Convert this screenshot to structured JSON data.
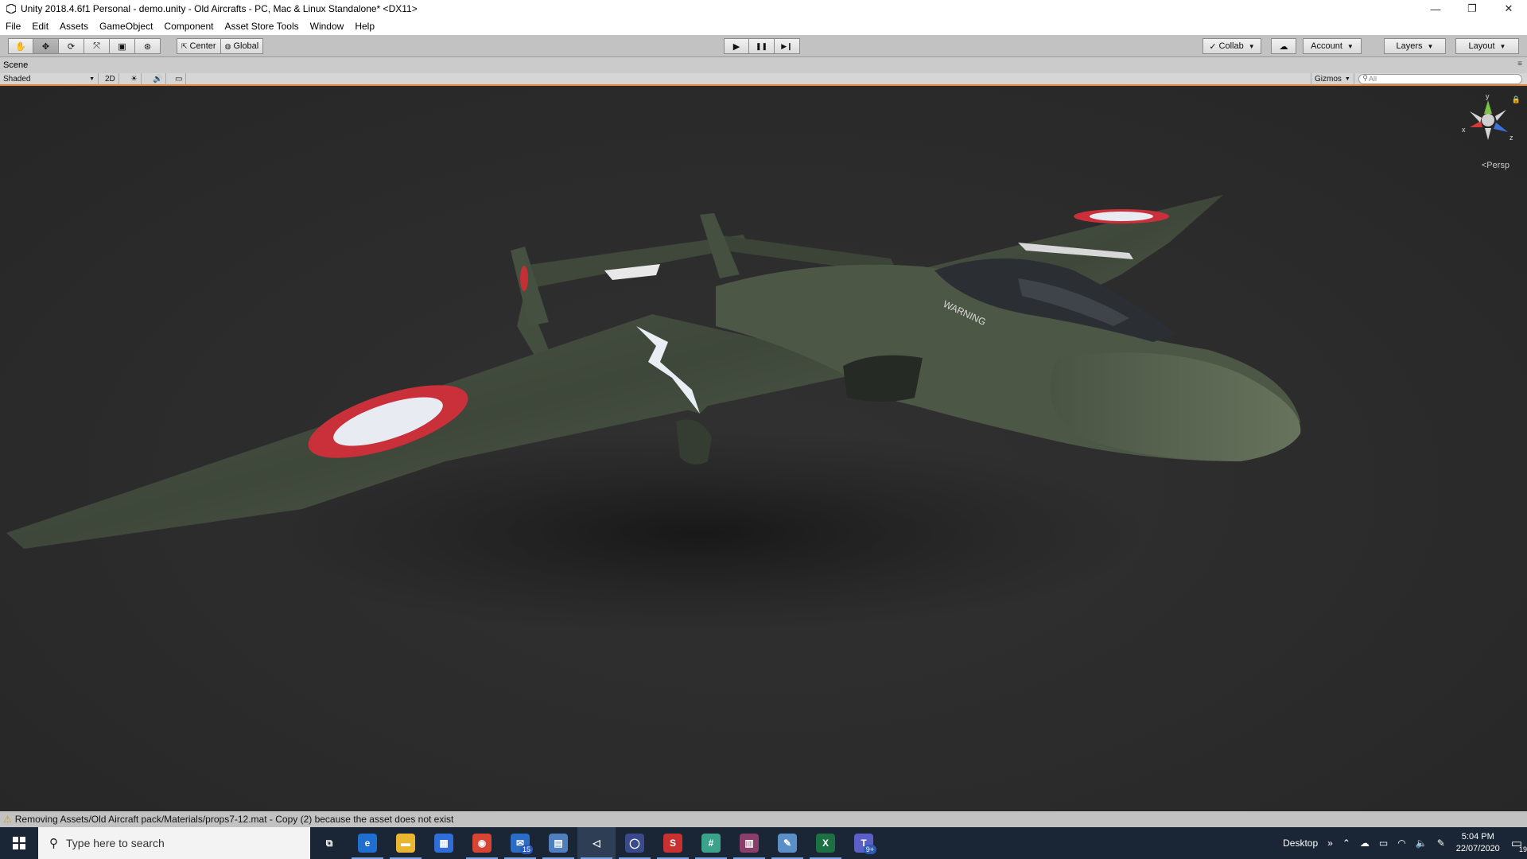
{
  "window": {
    "title": "Unity 2018.4.6f1 Personal - demo.unity - Old Aircrafts - PC, Mac & Linux Standalone* <DX11>",
    "minimize": "—",
    "restore": "❐",
    "close": "✕"
  },
  "menu": [
    "File",
    "Edit",
    "Assets",
    "GameObject",
    "Component",
    "Asset Store Tools",
    "Window",
    "Help"
  ],
  "toolbar": {
    "tools": [
      {
        "name": "hand-tool-icon",
        "glyph": "✋"
      },
      {
        "name": "move-tool-icon",
        "glyph": "✥"
      },
      {
        "name": "rotate-tool-icon",
        "glyph": "⟳"
      },
      {
        "name": "scale-tool-icon",
        "glyph": "⤧"
      },
      {
        "name": "rect-tool-icon",
        "glyph": "▣"
      },
      {
        "name": "transform-tool-icon",
        "glyph": "⊛"
      }
    ],
    "active_tool": 1,
    "pivot_mode": "Center",
    "pivot_rotation": "Global",
    "play": "▶",
    "pause": "❚❚",
    "step": "▶❙",
    "collab": "Collab",
    "cloud_icon": "☁",
    "account": "Account",
    "layers": "Layers",
    "layout": "Layout"
  },
  "scene": {
    "tab_label": "Scene",
    "shading_mode": "Shaded",
    "mode_2d": "2D",
    "lighting_icon": "☀",
    "audio_icon": "🔊",
    "effects_icon": "▭",
    "gizmos": "Gizmos",
    "search_placeholder": "All",
    "projection": "Persp",
    "axis_labels": {
      "y": "y",
      "x": "x",
      "z": "z"
    },
    "warning_decal": "WARNING"
  },
  "status": {
    "message": "Removing Assets/Old Aircraft pack/Materials/props7-12.mat - Copy (2) because the asset does not exist"
  },
  "taskbar": {
    "search_placeholder": "Type here to search",
    "apps": [
      {
        "name": "task-view-icon",
        "label": "⧉",
        "color": "#1a2535",
        "badge": ""
      },
      {
        "name": "edge-icon",
        "label": "e",
        "color": "#1f6fd1",
        "badge": ""
      },
      {
        "name": "file-explorer-icon",
        "label": "▬",
        "color": "#e8b631",
        "badge": ""
      },
      {
        "name": "store-icon",
        "label": "▦",
        "color": "#2f6ed8",
        "badge": ""
      },
      {
        "name": "chrome-icon",
        "label": "◉",
        "color": "#d64433",
        "badge": ""
      },
      {
        "name": "mail-icon",
        "label": "✉",
        "color": "#2b6cc4",
        "badge": "15"
      },
      {
        "name": "remote-desktop-icon",
        "label": "▤",
        "color": "#4f7fbd",
        "badge": ""
      },
      {
        "name": "unity-icon",
        "label": "◁",
        "color": "#2d3e55",
        "badge": ""
      },
      {
        "name": "cortana-icon",
        "label": "◯",
        "color": "#3a4a8a",
        "badge": ""
      },
      {
        "name": "snagit-icon",
        "label": "S",
        "color": "#c93030",
        "badge": ""
      },
      {
        "name": "slack-icon",
        "label": "#",
        "color": "#3aa38a",
        "badge": ""
      },
      {
        "name": "winrar-icon",
        "label": "▥",
        "color": "#8a3f6a",
        "badge": ""
      },
      {
        "name": "paint-icon",
        "label": "✎",
        "color": "#5a8fc8",
        "badge": ""
      },
      {
        "name": "excel-icon",
        "label": "X",
        "color": "#1d7044",
        "badge": ""
      },
      {
        "name": "teams-icon",
        "label": "T",
        "color": "#5b5fc7",
        "badge": "9+"
      }
    ],
    "active_app": 7,
    "desktop_label": "Desktop",
    "chevron": "»",
    "time": "5:04 PM",
    "date": "22/07/2020",
    "notification_count": "19"
  },
  "colors": {
    "accent_orange": "#e8873a",
    "plane_green": "#4a5443",
    "roundel_red": "#d02f35"
  }
}
